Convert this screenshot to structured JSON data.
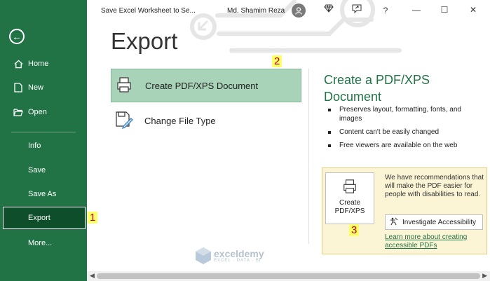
{
  "titlebar": {
    "doc_title": "Save Excel Worksheet to Se...",
    "user_name": "Md. Shamim Reza",
    "help": "?",
    "minimize": "—",
    "maximize": "☐",
    "close": "✕"
  },
  "sidebar": {
    "items": [
      {
        "label": "Home",
        "icon": "home-icon"
      },
      {
        "label": "New",
        "icon": "new-document-icon"
      },
      {
        "label": "Open",
        "icon": "folder-open-icon"
      },
      {
        "label": "Info"
      },
      {
        "label": "Save"
      },
      {
        "label": "Save As"
      },
      {
        "label": "Export",
        "selected": true
      },
      {
        "label": "More..."
      }
    ]
  },
  "main": {
    "page_title": "Export",
    "options": [
      {
        "label": "Create PDF/XPS Document",
        "icon": "pdf-document-icon",
        "selected": true
      },
      {
        "label": "Change File Type",
        "icon": "change-file-type-icon"
      }
    ]
  },
  "right_panel": {
    "title": "Create a PDF/XPS Document",
    "bullets": [
      "Preserves layout, formatting, fonts, and images",
      "Content can't be easily changed",
      "Free viewers are available on the web"
    ],
    "create_button": {
      "line1": "Create",
      "line2": "PDF/XPS"
    },
    "accessibility": {
      "text": "We have recommendations that will make the PDF easier for people with disabilities to read.",
      "button_label": "Investigate Accessibility",
      "link": "Learn more about creating accessible PDFs"
    }
  },
  "badges": [
    "1",
    "2",
    "3"
  ],
  "watermark": {
    "name": "exceldemy",
    "tagline": "EXCEL · DATA · BI"
  },
  "colors": {
    "accent": "#217346",
    "selected_option": "#a8d3b8",
    "badge_text": "#c00000",
    "badge_bg": "#ffff66"
  }
}
